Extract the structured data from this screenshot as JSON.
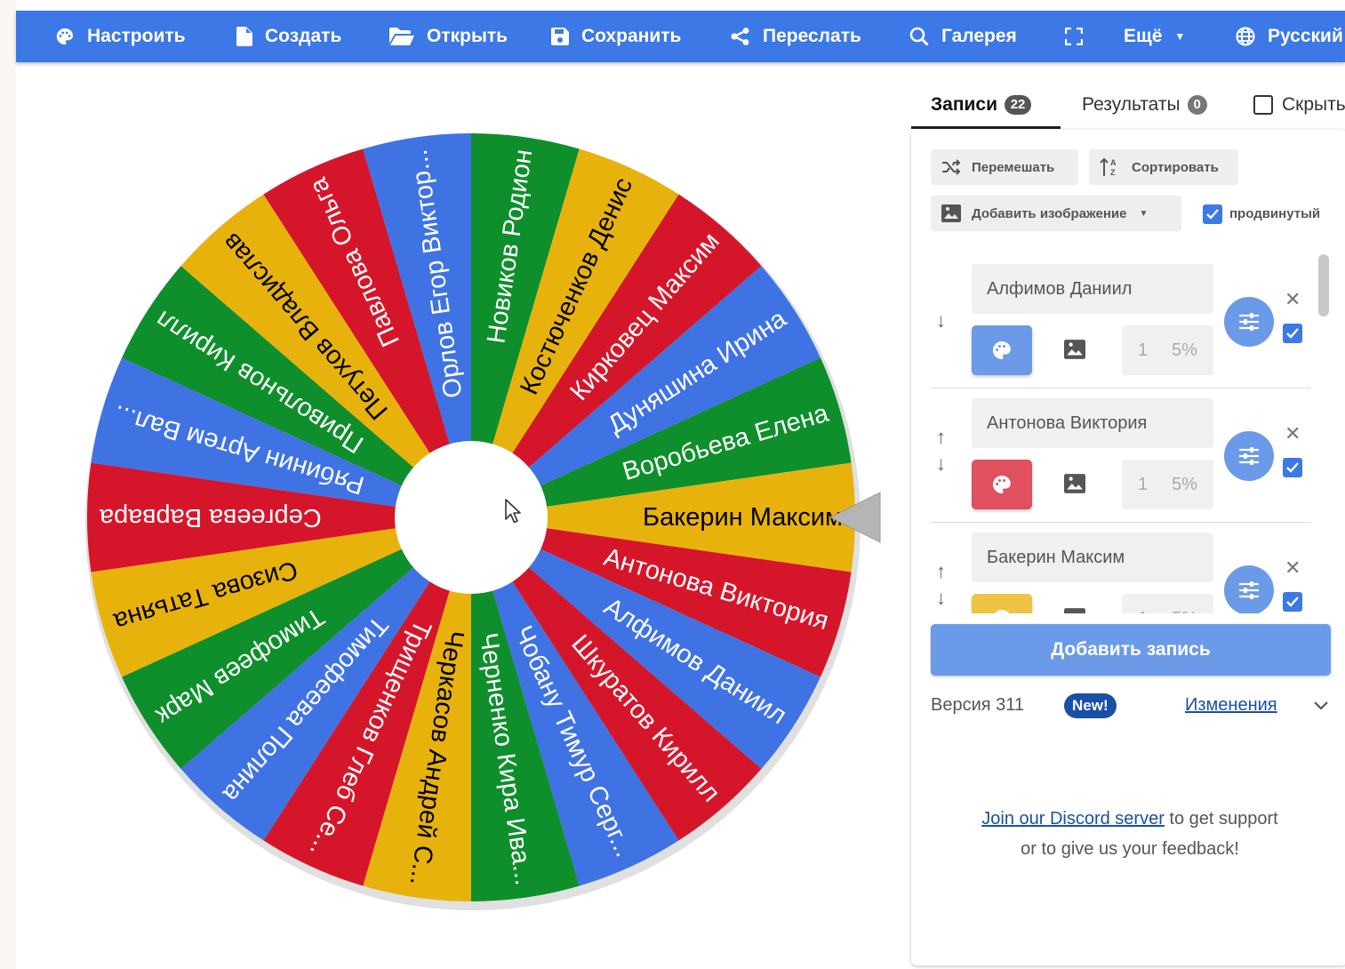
{
  "toolbar": {
    "items": [
      {
        "label": "Настроить",
        "icon": "palette-icon"
      },
      {
        "label": "Создать",
        "icon": "file-icon"
      },
      {
        "label": "Открыть",
        "icon": "folder-open-icon"
      },
      {
        "label": "Сохранить",
        "icon": "save-icon"
      },
      {
        "label": "Переслать",
        "icon": "share-icon"
      },
      {
        "label": "Галерея",
        "icon": "search-icon"
      },
      {
        "label": "",
        "icon": "fullscreen-icon"
      },
      {
        "label": "Ещё",
        "icon": "caret-down-icon"
      },
      {
        "label": "Русский",
        "icon": "globe-icon"
      }
    ],
    "color": "#3c78e6"
  },
  "wheel": {
    "colors": {
      "green": "#0e8f2c",
      "yellow": "#e8b20c",
      "red": "#d5162a",
      "blue": "#3f73e3"
    },
    "pointer_color": "#b5b5b5",
    "segments": [
      {
        "label": "Бакерин Максим",
        "color": "yellow"
      },
      {
        "label": "Антонова Виктория",
        "color": "red"
      },
      {
        "label": "Алфимов Даниил",
        "color": "blue"
      },
      {
        "label": "Шкуратов Кирилл",
        "color": "red"
      },
      {
        "label": "Чобану Тимур Серг...",
        "color": "blue"
      },
      {
        "label": "Черненко Кира Ива...",
        "color": "green"
      },
      {
        "label": "Черкасов Андрей С...",
        "color": "yellow"
      },
      {
        "label": "Трищенков Глеб Се...",
        "color": "red"
      },
      {
        "label": "Тимофеева Полина",
        "color": "blue"
      },
      {
        "label": "Тимофеев Марк",
        "color": "green"
      },
      {
        "label": "Сизова Татьяна",
        "color": "yellow"
      },
      {
        "label": "Сергеева Варвара",
        "color": "red"
      },
      {
        "label": "Рябинин Артем Вал...",
        "color": "blue"
      },
      {
        "label": "Привольнов Кирилл",
        "color": "green"
      },
      {
        "label": "Петухов Владислав",
        "color": "yellow"
      },
      {
        "label": "Павлова Ольга",
        "color": "red"
      },
      {
        "label": "Орлов Егор Виктор...",
        "color": "blue"
      },
      {
        "label": "Новиков Родион",
        "color": "green"
      },
      {
        "label": "Костюченков Денис",
        "color": "yellow"
      },
      {
        "label": "Кирковец Максим",
        "color": "red"
      },
      {
        "label": "Дуняшина Ирина",
        "color": "blue"
      },
      {
        "label": "Воробьева Елена",
        "color": "green"
      }
    ]
  },
  "tabs": {
    "entries_label": "Записи",
    "entries_count": "22",
    "results_label": "Результаты",
    "results_count": "0",
    "hide_label": "Скрыть"
  },
  "panel": {
    "shuffle_label": "Перемешать",
    "sort_label": "Сортировать",
    "add_image_label": "Добавить изображение",
    "advanced_label": "продвинутый",
    "advanced_checked": true,
    "entries": [
      {
        "name": "Алфимов Даниил",
        "weight": "1",
        "percent": "5%",
        "color": "#6b9ae8",
        "enabled": true
      },
      {
        "name": "Антонова Виктория",
        "weight": "1",
        "percent": "5%",
        "color": "#e0505e",
        "enabled": true
      },
      {
        "name": "Бакерин Максим",
        "weight": "1",
        "percent": "5%",
        "color": "#efc444",
        "enabled": true
      }
    ],
    "add_entry_label": "Добавить запись",
    "version_label": "Версия 311",
    "new_badge": "New!",
    "changes_label": "Изменения",
    "discord_link": "Join our Discord server",
    "discord_text": " to get support or to give us your feedback!"
  }
}
